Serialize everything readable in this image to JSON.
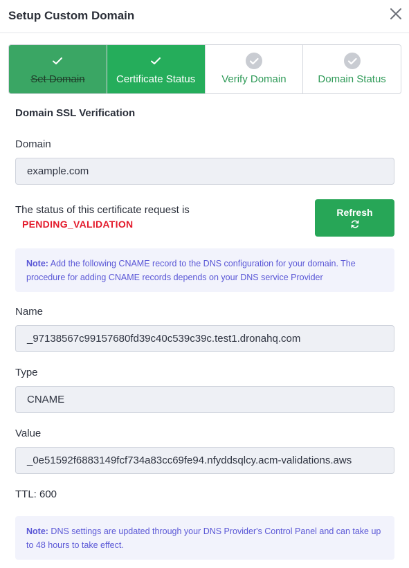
{
  "dialog": {
    "title": "Setup Custom Domain",
    "close_icon": "close-icon"
  },
  "steps": [
    {
      "label": "Set Domain",
      "state": "completed",
      "icon": "check-icon"
    },
    {
      "label": "Certificate Status",
      "state": "active",
      "icon": "check-icon"
    },
    {
      "label": "Verify Domain",
      "state": "pending",
      "icon": "check-circle-icon"
    },
    {
      "label": "Domain Status",
      "state": "pending",
      "icon": "check-circle-icon"
    }
  ],
  "section_title": "Domain SSL Verification",
  "domain": {
    "label": "Domain",
    "value": "example.com"
  },
  "certificate": {
    "status_text": "The status of this certificate request is",
    "status_value": "PENDING_VALIDATION",
    "refresh_label": "Refresh",
    "refresh_icon": "refresh-icon"
  },
  "note1": {
    "prefix": "Note:",
    "text": " Add the following CNAME record to the DNS configuration for your domain. The procedure for adding CNAME records depends on your DNS service Provider"
  },
  "record": {
    "name_label": "Name",
    "name_value": "_97138567c99157680fd39c40c539c39c.test1.dronahq.com",
    "type_label": "Type",
    "type_value": "CNAME",
    "value_label": "Value",
    "value_value": "_0e51592f6883149fcf734a83cc69fe94.nfyddsqlcy.acm-validations.aws",
    "ttl": "TTL: 600"
  },
  "note2": {
    "prefix": "Note:",
    "text": " DNS settings are updated through your DNS Provider's Control Panel and can take up to 48 hours to take effect."
  },
  "colors": {
    "primary_green": "#27a657",
    "completed_step": "#3aa664",
    "status_red": "#e3192a",
    "note_text": "#5a57d6",
    "note_bg": "#f2f3fc",
    "input_bg": "#eef0f5"
  }
}
